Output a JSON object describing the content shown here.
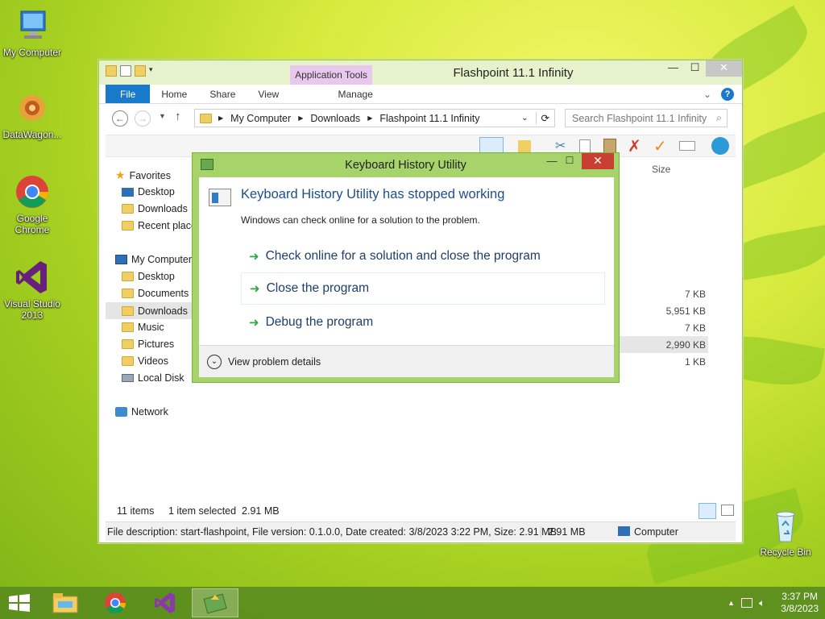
{
  "desktop": {
    "icons": [
      {
        "label": "My Computer"
      },
      {
        "label": "DataWagon..."
      },
      {
        "label": "Google Chrome"
      },
      {
        "label": "Visual Studio 2013"
      },
      {
        "label": "Recycle Bin"
      }
    ]
  },
  "explorer": {
    "title": "Flashpoint 11.1 Infinity",
    "context_tab": "Application Tools",
    "ribbon_tabs": [
      "File",
      "Home",
      "Share",
      "View",
      "Manage"
    ],
    "address": [
      "My Computer",
      "Downloads",
      "Flashpoint 11.1 Infinity"
    ],
    "search_placeholder": "Search Flashpoint 11.1 Infinity",
    "column_size": "Size",
    "nav": {
      "favorites": "Favorites",
      "fav_items": [
        "Desktop",
        "Downloads",
        "Recent places"
      ],
      "computer": "My Computer",
      "computer_items": [
        "Desktop",
        "Documents",
        "Downloads",
        "Music",
        "Pictures",
        "Videos",
        "Local Disk"
      ],
      "network": "Network"
    },
    "sizes": [
      "7 KB",
      "5,951 KB",
      "7 KB",
      "2,990 KB",
      "1 KB"
    ],
    "status": {
      "items": "11 items",
      "selected": "1 item selected  2.91 MB"
    },
    "details": {
      "description": "File description: start-flashpoint, File version: 0.1.0.0, Date created: 3/8/2023 3:22 PM, Size: 2.91 MB",
      "size": "2.91 MB",
      "location": "Computer"
    }
  },
  "dialog": {
    "title": "Keyboard History Utility",
    "heading": "Keyboard History Utility has stopped working",
    "subtext": "Windows can check online for a solution to the problem.",
    "options": [
      "Check online for a solution and close the program",
      "Close the program",
      "Debug the program"
    ],
    "details_label": "View problem details"
  },
  "taskbar": {
    "time": "3:37 PM",
    "date": "3/8/2023"
  },
  "colors": {
    "accent": "#1979ca",
    "dialog_frame": "#a6d36a",
    "taskbar": "#5a8c1e"
  }
}
